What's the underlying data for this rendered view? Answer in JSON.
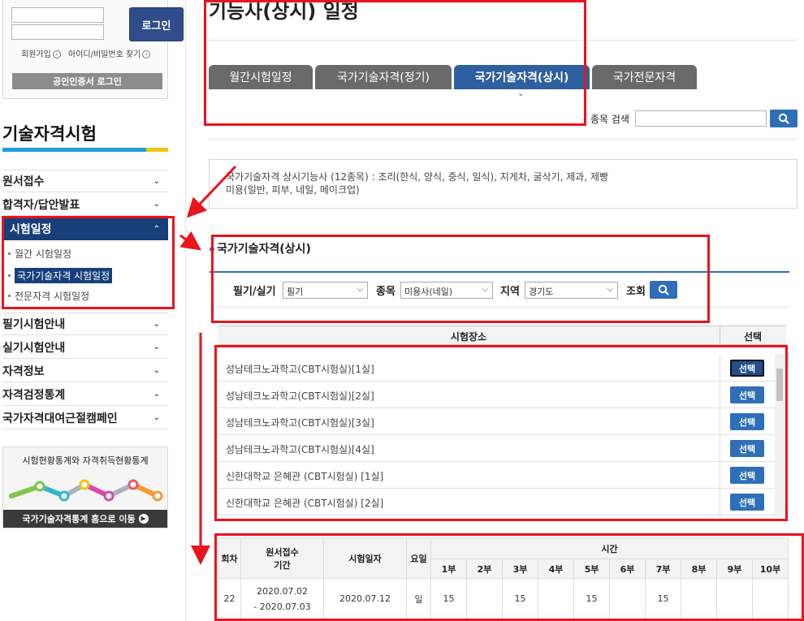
{
  "login": {
    "button_label": "로그인",
    "signup_link": "회원가입",
    "find_id_link": "아이디/비밀번호 찾기",
    "cert_login_label": "공인인증서 로그인"
  },
  "sidebar": {
    "title": "기술자격시험",
    "items": [
      {
        "label": "원서접수"
      },
      {
        "label": "합격자/답안발표"
      },
      {
        "label": "시험일정"
      },
      {
        "label": "필기시험안내"
      },
      {
        "label": "실기시험안내"
      },
      {
        "label": "자격정보"
      },
      {
        "label": "자격검정통계"
      },
      {
        "label": "국가자격대여근절캠페인"
      }
    ],
    "sub_items": [
      {
        "label": "월간 시험일정"
      },
      {
        "label": "국가기술자격 시험일정"
      },
      {
        "label": "전문자격 시험일정"
      }
    ],
    "stats_banner": {
      "title": "시험현황통계와 자격취득현황통계",
      "link": "국가기술자격통계 홈으로 이동"
    }
  },
  "page": {
    "title": "기능사(상시) 일정",
    "tabs": [
      {
        "label": "월간시험일정"
      },
      {
        "label": "국가기술자격(정기)"
      },
      {
        "label": "국가기술자격(상시)"
      },
      {
        "label": "국가전문자격"
      }
    ],
    "search_label": "종목 검색",
    "search_placeholder": "",
    "info_line1": "국가기술자격 상시기능사 (12종목) : 조리(한식, 양식, 중식, 일식), 지게차, 굴삭기, 제과, 제빵",
    "info_line2": "미용(일반, 피부, 네일, 메이크업)",
    "section_title": "국가기술자격(상시)"
  },
  "filters": {
    "type_label": "필기/실기",
    "type_value": "필기",
    "subject_label": "종목",
    "subject_value": "미용사(네일)",
    "region_label": "지역",
    "region_value": "경기도",
    "search_label": "조회"
  },
  "venues": {
    "col_place": "시험장소",
    "col_select": "선택",
    "select_label": "선택",
    "rows": [
      "성남테크노과학고(CBT시험실)[1실]",
      "성남테크노과학고(CBT시험실)[2실]",
      "성남테크노과학고(CBT시험실)[3실]",
      "성남테크노과학고(CBT시험실)[4실]",
      "신한대학교 은혜관 (CBT시험실) [1실]",
      "신한대학교 은혜관 (CBT시험실) [2실]"
    ]
  },
  "schedule": {
    "h_round": "회차",
    "h_apply_1": "원서접수",
    "h_apply_2": "기간",
    "h_date": "시험일자",
    "h_day": "요일",
    "h_time": "시간",
    "parts": [
      "1부",
      "2부",
      "3부",
      "4부",
      "5부",
      "6부",
      "7부",
      "8부",
      "9부",
      "10부"
    ],
    "row": {
      "round": "22",
      "apply_start": "2020.07.02",
      "apply_end": "- 2020.07.03",
      "date": "2020.07.12",
      "day": "일",
      "slots": [
        "15",
        "",
        "15",
        "",
        "15",
        "",
        "15",
        "",
        "",
        ""
      ]
    }
  },
  "colors": {
    "accent": "#2e6fb8",
    "nav_dark": "#173f7a",
    "annotation": "#e8141e"
  }
}
